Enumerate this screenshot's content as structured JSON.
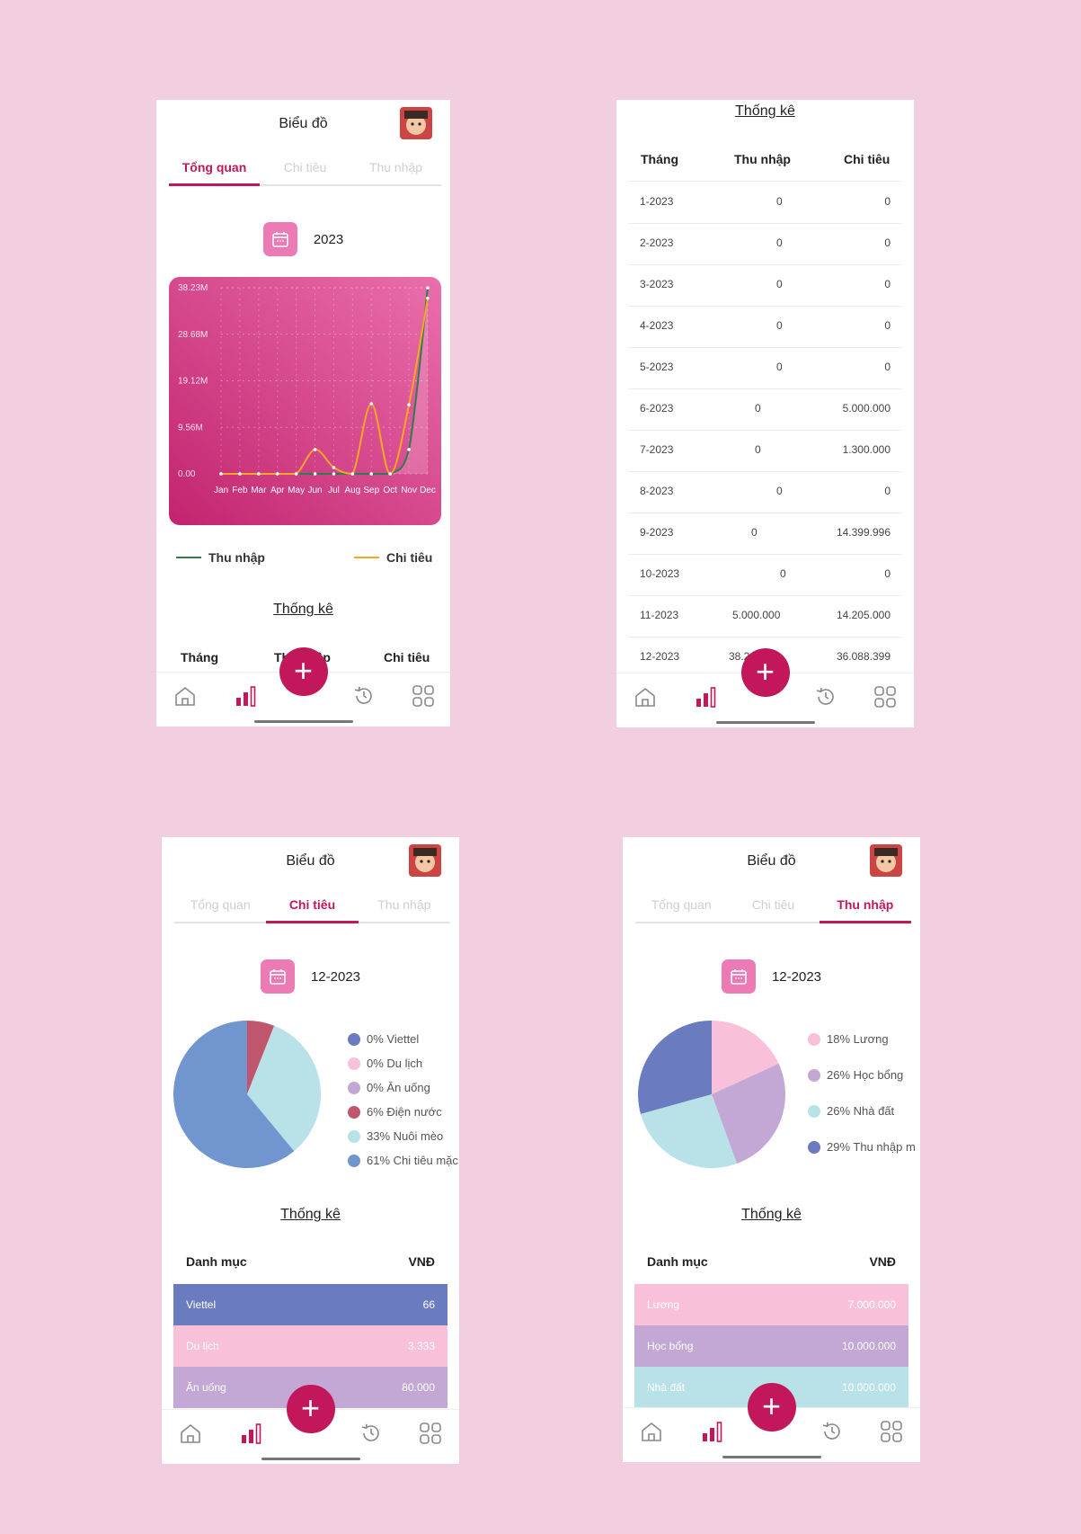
{
  "colors": {
    "background": "#f2cfe0",
    "accent": "#c2185b",
    "calendar_button": "#ec7ab4",
    "income_line": "#2e7d4f",
    "expense_line": "#f5a623"
  },
  "header": {
    "title": "Biểu đồ"
  },
  "tabs": [
    "Tổng quan",
    "Chi tiêu",
    "Thu nhập"
  ],
  "fab_label": "+",
  "icons": {
    "nav": [
      "home-icon",
      "bar-chart-icon",
      "history-icon",
      "grid-icon"
    ],
    "calendar": "calendar-icon"
  },
  "overview": {
    "year": "2023",
    "legend": {
      "income": "Thu nhập",
      "expense": "Chi tiêu"
    },
    "stats_title": "Thống kê",
    "table_header": {
      "month": "Tháng",
      "income": "Thu nhập",
      "expense": "Chi tiêu"
    }
  },
  "chart_data": {
    "type": "line",
    "categories": [
      "Jan",
      "Feb",
      "Mar",
      "Apr",
      "May",
      "Jun",
      "Jul",
      "Aug",
      "Sep",
      "Oct",
      "Nov",
      "Dec"
    ],
    "y_ticks": [
      "38.23M",
      "28.68M",
      "19.12M",
      "9.56M",
      "0.00"
    ],
    "ylim": [
      0,
      38.23
    ],
    "series": [
      {
        "name": "Thu nhập",
        "values": [
          0,
          0,
          0,
          0,
          0,
          0,
          0,
          0,
          0,
          0,
          5,
          38.2
        ]
      },
      {
        "name": "Chi tiêu",
        "values": [
          0,
          0,
          0,
          0,
          0,
          5,
          1.3,
          0,
          14.4,
          0,
          14.2,
          36.1
        ]
      }
    ]
  },
  "stats": {
    "title": "Thống kê",
    "header": {
      "month": "Tháng",
      "income": "Thu nhập",
      "expense": "Chi tiêu"
    },
    "rows": [
      {
        "month": "1-2023",
        "income": "0",
        "expense": "0"
      },
      {
        "month": "2-2023",
        "income": "0",
        "expense": "0"
      },
      {
        "month": "3-2023",
        "income": "0",
        "expense": "0"
      },
      {
        "month": "4-2023",
        "income": "0",
        "expense": "0"
      },
      {
        "month": "5-2023",
        "income": "0",
        "expense": "0"
      },
      {
        "month": "6-2023",
        "income": "0",
        "expense": "5.000.000"
      },
      {
        "month": "7-2023",
        "income": "0",
        "expense": "1.300.000"
      },
      {
        "month": "8-2023",
        "income": "0",
        "expense": "0"
      },
      {
        "month": "9-2023",
        "income": "0",
        "expense": "14.399.996"
      },
      {
        "month": "10-2023",
        "income": "0",
        "expense": "0"
      },
      {
        "month": "11-2023",
        "income": "5.000.000",
        "expense": "14.205.000"
      },
      {
        "month": "12-2023",
        "income": "38.2",
        "expense": "36.088.399"
      }
    ]
  },
  "expense": {
    "date": "12-2023",
    "legend": [
      "0% Viettel",
      "0% Du lịch",
      "0% Ăn uống",
      "6% Điện nước",
      "33% Nuôi mèo",
      "61% Chi tiêu mặc"
    ],
    "legend_colors": [
      "#6b7bbf",
      "#f8c1d9",
      "#c3a8d6",
      "#c0566e",
      "#b8e2e8",
      "#7195cf"
    ],
    "pie": [
      {
        "label": "Điện nước",
        "percent": 6,
        "color": "#c0566e"
      },
      {
        "label": "Nuôi mèo",
        "percent": 33,
        "color": "#b8e2e8"
      },
      {
        "label": "Chi tiêu mặc",
        "percent": 61,
        "color": "#7195cf"
      }
    ],
    "stats_title": "Thống kê",
    "table_header": {
      "category": "Danh mục",
      "amount": "VNĐ"
    },
    "rows": [
      {
        "category": "Viettel",
        "amount": "66",
        "color": "#6b7bbf"
      },
      {
        "category": "Du lịch",
        "amount": "3.333",
        "color": "#f8c1d9"
      },
      {
        "category": "Ăn uống",
        "amount": "80.000",
        "color": "#c3a8d6"
      }
    ]
  },
  "income": {
    "date": "12-2023",
    "legend": [
      "18% Lương",
      "26% Học bổng",
      "26% Nhà đất",
      "29% Thu nhập m"
    ],
    "legend_colors": [
      "#f8c1d9",
      "#c3a8d6",
      "#b8e2e8",
      "#6b7bbf"
    ],
    "pie": [
      {
        "label": "Lương",
        "percent": 18,
        "color": "#f8c1d9"
      },
      {
        "label": "Học bổng",
        "percent": 26,
        "color": "#c3a8d6"
      },
      {
        "label": "Nhà đất",
        "percent": 26,
        "color": "#b8e2e8"
      },
      {
        "label": "Thu nhập m",
        "percent": 29,
        "color": "#6b7bbf"
      }
    ],
    "stats_title": "Thống kê",
    "table_header": {
      "category": "Danh mục",
      "amount": "VNĐ"
    },
    "rows": [
      {
        "category": "Lương",
        "amount": "7.000.000",
        "color": "#f8c1d9"
      },
      {
        "category": "Học bổng",
        "amount": "10.000.000",
        "color": "#c3a8d6"
      },
      {
        "category": "Nhà đất",
        "amount": "10.000.000",
        "color": "#b8e2e8"
      }
    ]
  }
}
